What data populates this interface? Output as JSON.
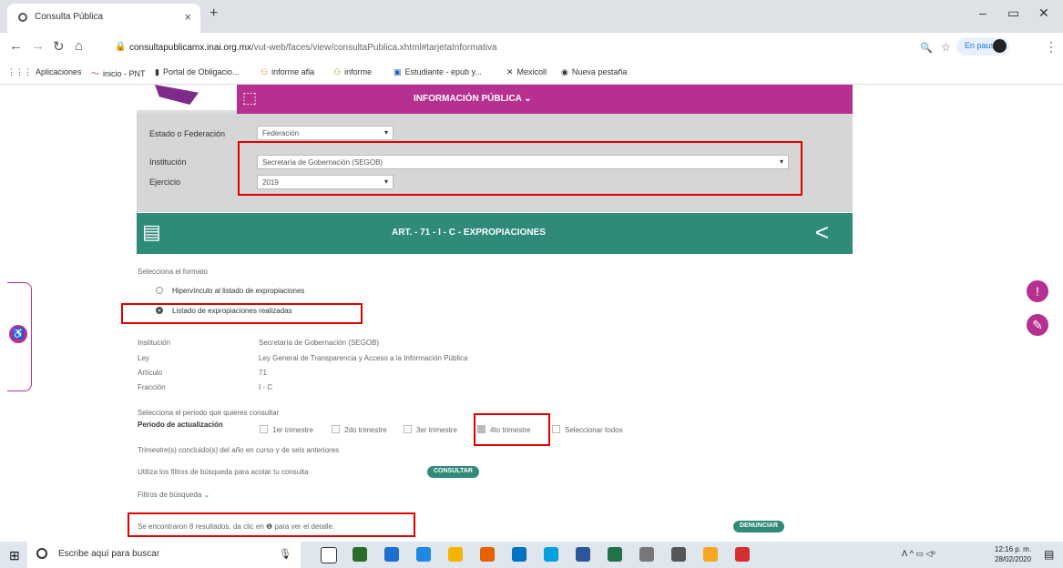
{
  "browser": {
    "tab_title": "Consulta Pública",
    "tab_close": "×",
    "new_tab": "+",
    "url_host": "consultapublicamx.inai.org.mx",
    "url_path": "/vut-web/faces/view/consultaPublica.xhtml#tarjetaInformativa",
    "paused_label": "En pausa",
    "bookmarks": [
      "Aplicaciones",
      "inicio - PNT",
      "Portal de Obligacio...",
      "informe afla",
      "informe",
      "Estudiante - epub y...",
      "Mexicoll",
      "Nueva pestaña"
    ]
  },
  "banner": {
    "title": "INFORMACIÓN PÚBLICA ⌄"
  },
  "filters": {
    "estado_label": "Estado o Federación",
    "estado_value": "Federación",
    "institucion_label": "Institución",
    "institucion_value": "Secretaría de Gobernación (SEGOB)",
    "ejercicio_label": "Ejercicio",
    "ejercicio_value": "2019"
  },
  "section": {
    "title": "ART. - 71 - I - C - EXPROPIACIONES"
  },
  "format": {
    "prompt": "Selecciona el formato",
    "options": [
      "Hipervínculo al listado de expropiaciones",
      "Listado de expropiaciones realizadas"
    ]
  },
  "details": [
    {
      "label": "Institución",
      "value": "Secretaría de Gobernación (SEGOB)"
    },
    {
      "label": "Ley",
      "value": "Ley General de Transparencia y Acceso a la Información Pública"
    },
    {
      "label": "Artículo",
      "value": "71"
    },
    {
      "label": "Fracción",
      "value": "I - C"
    }
  ],
  "period": {
    "prompt": "Selecciona el periodo que quieres consultar",
    "label": "Periodo de actualización",
    "options": [
      "1er trimestre",
      "2do trimestre",
      "3er trimestre",
      "4to trimestre",
      "Seleccionar todos"
    ],
    "checked": [
      false,
      false,
      false,
      true,
      false
    ],
    "note": "Trimestre(s) concluido(s) del año en curso y de seis anteriores",
    "hint": "Utiliza los filtros de búsqueda para acotar tu consulta",
    "consultar": "CONSULTAR",
    "filtros": "Filtros de búsqueda ⌄"
  },
  "results": {
    "text": "Se encontraron 8 resultados, da clic en ❶ para ver el detalle.",
    "denunciar": "DENUNCIAR"
  },
  "taskbar": {
    "search_placeholder": "Escribe aquí para buscar",
    "time": "12:16 p. m.",
    "date": "28/02/2020"
  },
  "colors": {
    "banner": "#b6308f",
    "section": "#2f8a7a",
    "highlight": "#e00000",
    "filters_bg": "#d6d6d6"
  }
}
